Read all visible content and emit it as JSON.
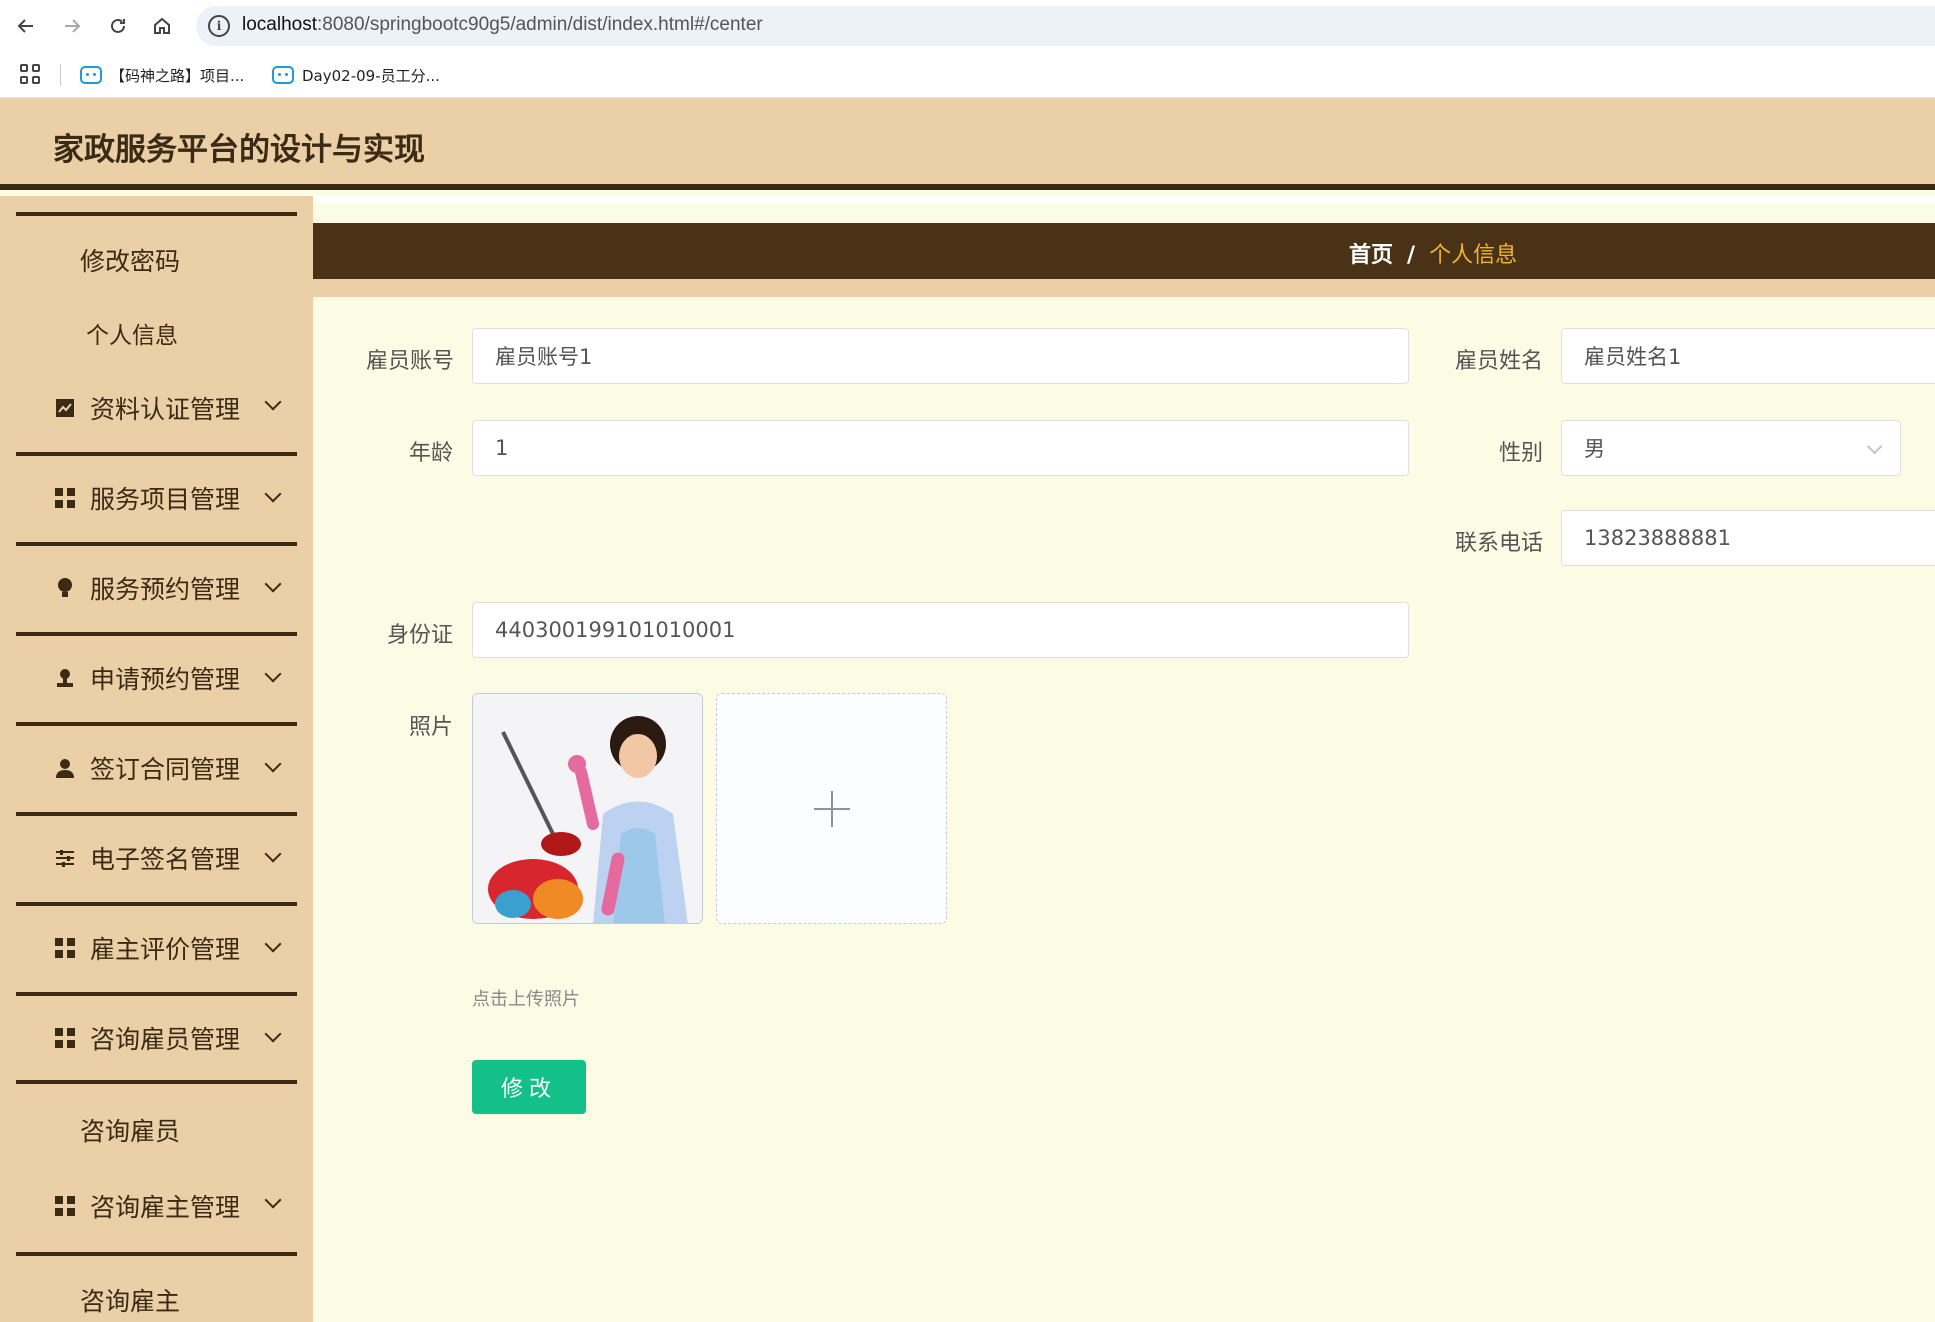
{
  "browser": {
    "url_host": "localhost",
    "url_rest": ":8080/springbootc90g5/admin/dist/index.html#/center",
    "bookmarks": [
      {
        "label": "【码神之路】项目..."
      },
      {
        "label": "Day02-09-员工分..."
      }
    ]
  },
  "app": {
    "title": "家政服务平台的设计与实现"
  },
  "sidebar": {
    "top_items": [
      "修改密码",
      "个人信息"
    ],
    "menus": [
      {
        "label": "资料认证管理",
        "icon": "chart-icon"
      },
      {
        "label": "服务项目管理",
        "icon": "grid-icon"
      },
      {
        "label": "服务预约管理",
        "icon": "bulb-icon"
      },
      {
        "label": "申请预约管理",
        "icon": "user-stamp-icon"
      },
      {
        "label": "签订合同管理",
        "icon": "user-icon"
      },
      {
        "label": "电子签名管理",
        "icon": "sliders-icon"
      },
      {
        "label": "雇主评价管理",
        "icon": "grid-icon"
      },
      {
        "label": "咨询雇员管理",
        "icon": "grid-icon"
      },
      {
        "label": "咨询雇主管理",
        "icon": "grid-icon"
      }
    ],
    "sub_consult_employee": "咨询雇员",
    "sub_consult_employer": "咨询雇主"
  },
  "breadcrumb": {
    "home": "首页",
    "separator": "/",
    "current": "个人信息"
  },
  "form": {
    "account_label": "雇员账号",
    "account_value": "雇员账号1",
    "name_label": "雇员姓名",
    "name_value": "雇员姓名1",
    "age_label": "年龄",
    "age_value": "1",
    "gender_label": "性别",
    "gender_value": "男",
    "phone_label": "联系电话",
    "phone_value": "13823888881",
    "id_label": "身份证",
    "id_value": "440300199101010001",
    "photo_label": "照片",
    "upload_tip": "点击上传照片",
    "submit_label": "修改"
  },
  "colors": {
    "header_bg": "#ebcfa6",
    "dark_brown": "#3b2a14",
    "breadcrumb_active": "#f1b52b",
    "content_bg": "#fcfbe3",
    "submit_green": "#13c08a"
  }
}
